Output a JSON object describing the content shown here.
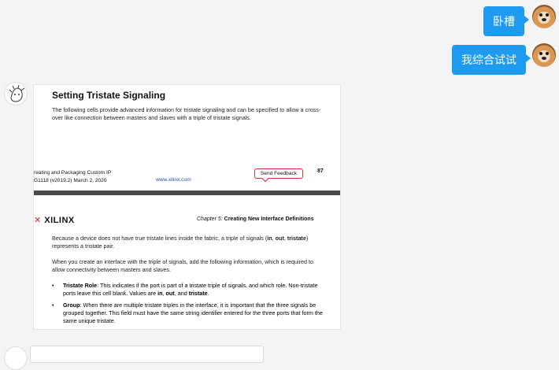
{
  "messages": {
    "msg1": "卧槽",
    "msg2": "我综合试试"
  },
  "icons": {
    "my_avatar": "dog-avatar-icon",
    "other_avatar": "sketch-avatar-icon"
  },
  "doc": {
    "heading": "Setting Tristate Signaling",
    "para1": "The following cells provide advanced information for tristate signaling and can be specified to allow a cross-over like connection between masters and slaves with a triple of tristate signals.",
    "footer_line1": "reating and Packaging Custom IP",
    "footer_line2": "G1118 (v2019.2) March 2, 2020",
    "footer_link": "www.xilinx.com",
    "feedback_label": "Send Feedback",
    "page_number": "87",
    "logo_text": "XILINX",
    "chapter_label": "Chapter 5:",
    "chapter_title": "Creating New Interface Definitions",
    "para2_a": "Because a device does not have true tristate lines inside the fabric, a triple of signals (",
    "para2_in": "in",
    "para2_b": ",",
    "para2_out": "out",
    "para2_c": ",",
    "para2_tristate": "tristate",
    "para2_d": ") represents a tristate pair.",
    "para3": "When you create an interface with the triple of signals, add the following information, which is required to allow connectivity between masters and slaves.",
    "bullet1_title": "Tristate Role",
    "bullet1_a": ": This indicates if the port is part of a tristate triple of signals, and which role. Non-tristate ports leave this cell blank. Values are ",
    "bullet1_in": "in",
    "bullet1_b": ", ",
    "bullet1_out": "out",
    "bullet1_c": ", and ",
    "bullet1_tristate": "tristate",
    "bullet1_d": ".",
    "bullet2_title": "Group",
    "bullet2_a": ": When there are multiple tristate triples in the interface, it is important that the three signals be grouped together. This field must have the same string identifier entered for the three ports that form the same unique tristate."
  },
  "colors": {
    "bubble": "#1e9bf0",
    "background": "#f4f4f4",
    "feedback_border": "#c43838",
    "xilinx_red": "#d22b2b"
  }
}
